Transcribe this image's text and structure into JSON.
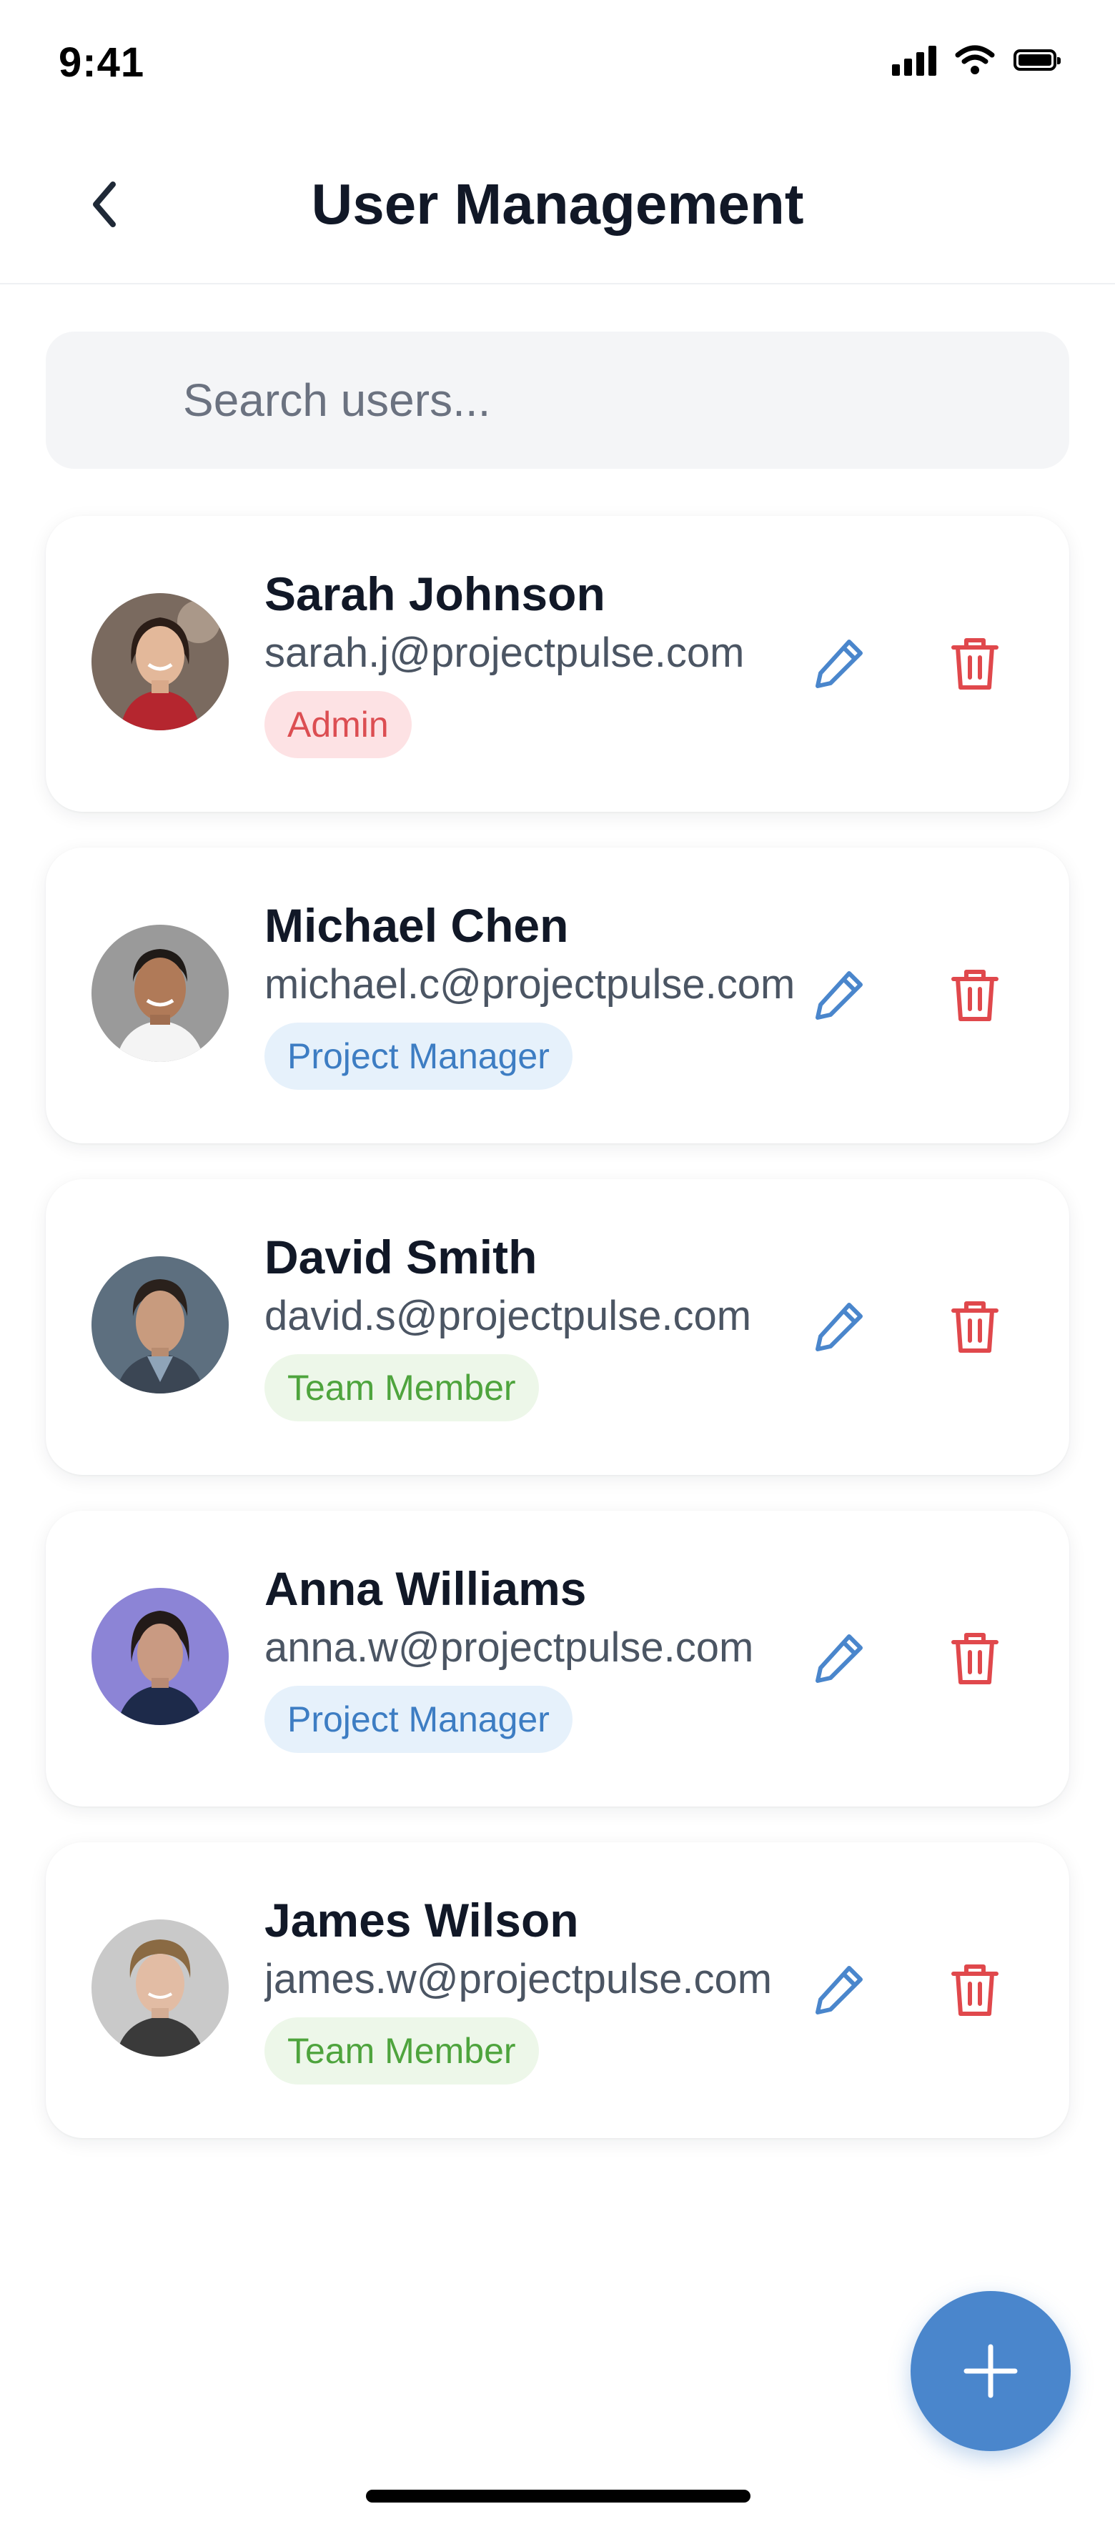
{
  "status_bar": {
    "time": "9:41",
    "icons": [
      "signal-icon",
      "wifi-icon",
      "battery-icon"
    ]
  },
  "header": {
    "title": "User Management",
    "back_icon": "chevron-left-icon"
  },
  "search": {
    "placeholder": "Search users...",
    "value": ""
  },
  "users": [
    {
      "name": "Sarah Johnson",
      "email": "sarah.j@projectpulse.com",
      "role": "Admin"
    },
    {
      "name": "Michael Chen",
      "email": "michael.c@projectpulse.com",
      "role": "Project Manager"
    },
    {
      "name": "David Smith",
      "email": "david.s@projectpulse.com",
      "role": "Team Member"
    },
    {
      "name": "Anna Williams",
      "email": "anna.w@projectpulse.com",
      "role": "Project Manager"
    },
    {
      "name": "James Wilson",
      "email": "james.w@projectpulse.com",
      "role": "Team Member"
    }
  ],
  "actions": {
    "edit_icon": "pencil-icon",
    "delete_icon": "trash-icon",
    "add_icon": "plus-icon"
  },
  "colors": {
    "accent": "#4a86cc",
    "danger": "#e0484c",
    "admin_badge_bg": "#fde2e4",
    "admin_badge_text": "#dc4e52",
    "pm_badge_bg": "#e6f1fb",
    "pm_badge_text": "#3d7dc3",
    "team_badge_bg": "#edf7e9",
    "team_badge_text": "#4ea43d"
  }
}
